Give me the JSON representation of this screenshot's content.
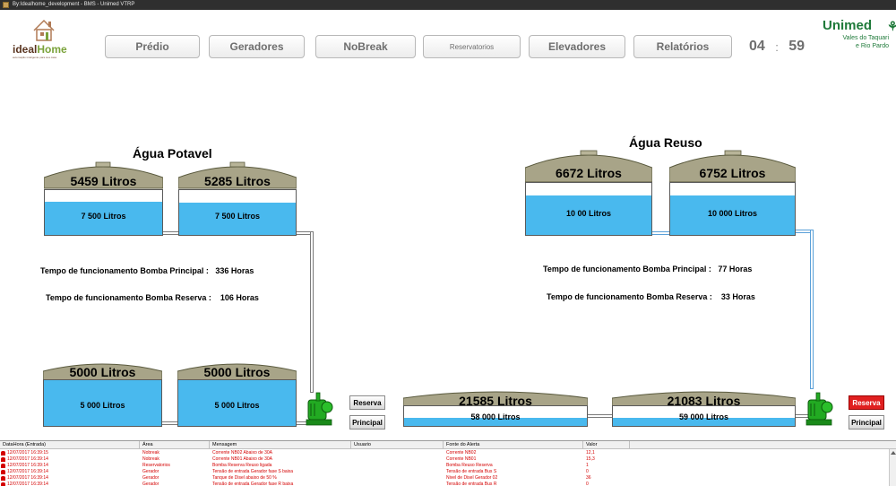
{
  "window": {
    "title": "By:Idealhome_development - BMS - Unimed VTRP"
  },
  "logo": {
    "brand_main": "ideal",
    "brand_accent": "Home",
    "tagline": "automação inteligente para sua casa"
  },
  "nav": [
    {
      "label": "Prédio"
    },
    {
      "label": "Geradores"
    },
    {
      "label": "NoBreak"
    },
    {
      "label": "Reservatorios"
    },
    {
      "label": "Elevadores"
    },
    {
      "label": "Relatórios"
    }
  ],
  "clock": {
    "hours": "04",
    "sep": ":",
    "minutes": "59"
  },
  "unimed": {
    "name": "Unimed",
    "line1": "Vales do Taquari",
    "line2": "e Rio Pardo"
  },
  "potavel": {
    "title": "Água Potavel",
    "upper_tanks": [
      {
        "level": "5459 Litros",
        "capacity": "7 500 Litros"
      },
      {
        "level": "5285 Litros",
        "capacity": "7 500 Litros"
      }
    ],
    "lower_tanks": [
      {
        "level": "5000 Litros",
        "capacity": "5 000 Litros"
      },
      {
        "level": "5000 Litros",
        "capacity": "5 000 Litros"
      }
    ],
    "pump_main_label": "Tempo de funcionamento Bomba Principal :",
    "pump_main_value": "336 Horas",
    "pump_reserve_label": "Tempo de funcionamento Bomba Reserva :",
    "pump_reserve_value": "106 Horas",
    "btn_reserve": "Reserva",
    "btn_main": "Principal"
  },
  "reuso": {
    "title": "Água Reuso",
    "upper_tanks": [
      {
        "level": "6672 Litros",
        "capacity": "10 00 Litros"
      },
      {
        "level": "6752 Litros",
        "capacity": "10 000 Litros"
      }
    ],
    "lower_tanks": [
      {
        "level": "21585 Litros",
        "capacity": "58 000 Litros"
      },
      {
        "level": "21083 Litros",
        "capacity": "59 000 Litros"
      }
    ],
    "pump_main_label": "Tempo de funcionamento Bomba Principal :",
    "pump_main_value": "77 Horas",
    "pump_reserve_label": "Tempo de funcionamento Bomba Reserva :",
    "pump_reserve_value": "33 Horas",
    "btn_reserve": "Reserva",
    "btn_main": "Principal"
  },
  "alarms": {
    "columns": [
      "DataHora (Entrada)",
      "Área",
      "Mensagem",
      "Usuario",
      "Fonte do Alerta",
      "Valor"
    ],
    "rows": [
      [
        "12/07/2017 16:39:15",
        "Nobreak",
        "Corrente NB02 Abaixo de 30A",
        "",
        "Corrente NB02",
        "12,1"
      ],
      [
        "12/07/2017 16:39:14",
        "Nobreak",
        "Corrente NB01 Abaixo de 30A",
        "",
        "Corrente NB01",
        "15,3"
      ],
      [
        "12/07/2017 16:39:14",
        "Reservatorios",
        "Bomba Reserva Reuso ligada",
        "",
        "Bomba Reuso Reserva",
        "1"
      ],
      [
        "12/07/2017 16:39:14",
        "Gerador",
        "Tensão de entrada Gerador fase S baixa",
        "",
        "Tensão de entrada Bus S",
        "0"
      ],
      [
        "12/07/2017 16:39:14",
        "Gerador",
        "Tanque de Disel abaixo de 50 %",
        "",
        "Nivel de Disel Gerador 02",
        "36"
      ],
      [
        "12/07/2017 16:39:14",
        "Gerador",
        "Tensão de entrada Gerador fase R baixa",
        "",
        "Tensão de entrada Bus R",
        "0"
      ]
    ]
  },
  "colors": {
    "water": "#49b9ee",
    "roof": "#a8a488",
    "alarm_text": "#d40000",
    "pump": "#22aa22"
  }
}
